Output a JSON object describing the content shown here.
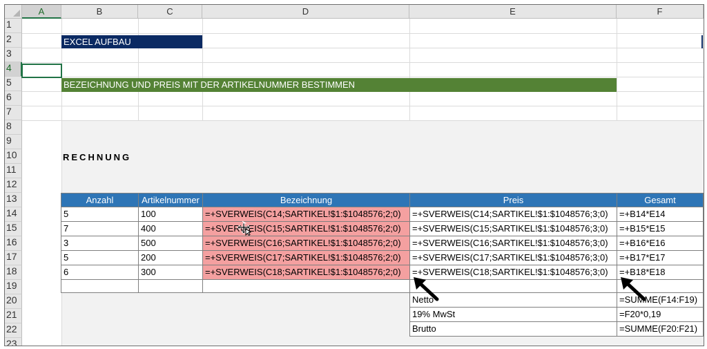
{
  "columns": [
    "A",
    "B",
    "C",
    "D",
    "E",
    "F"
  ],
  "rows": [
    "1",
    "2",
    "3",
    "4",
    "5",
    "6",
    "7",
    "8",
    "9",
    "10",
    "11",
    "12",
    "13",
    "14",
    "15",
    "16",
    "17",
    "18",
    "19",
    "20",
    "21",
    "22",
    "23"
  ],
  "cells": {
    "title": "EXCEL AUFBAU",
    "subtitle": "BEZEICHNUNG UND PREIS  MIT DER ARTIKELNUMMER BESTIMMEN",
    "invoice_heading": "RECHNUNG"
  },
  "table": {
    "headers": [
      "Anzahl",
      "Artikelnummer",
      "Bezeichnung",
      "Preis",
      "Gesamt"
    ],
    "rows": [
      [
        "5",
        "100",
        "=+SVERWEIS(C14;SARTIKEL!$1:$1048576;2;0)",
        "=+SVERWEIS(C14;SARTIKEL!$1:$1048576;3;0)",
        "=+B14*E14"
      ],
      [
        "7",
        "400",
        "=+SVERWEIS(C15;SARTIKEL!$1:$1048576;2;0)",
        "=+SVERWEIS(C15;SARTIKEL!$1:$1048576;3;0)",
        "=+B15*E15"
      ],
      [
        "3",
        "500",
        "=+SVERWEIS(C16;SARTIKEL!$1:$1048576;2;0)",
        "=+SVERWEIS(C16;SARTIKEL!$1:$1048576;3;0)",
        "=+B16*E16"
      ],
      [
        "5",
        "200",
        "=+SVERWEIS(C17;SARTIKEL!$1:$1048576;2;0)",
        "=+SVERWEIS(C17;SARTIKEL!$1:$1048576;3;0)",
        "=+B17*E17"
      ],
      [
        "6",
        "300",
        "=+SVERWEIS(C18;SARTIKEL!$1:$1048576;2;0)",
        "=+SVERWEIS(C18;SARTIKEL!$1:$1048576;3;0)",
        "=+B18*E18"
      ]
    ]
  },
  "summary": [
    {
      "label": "Netto",
      "formula": "=SUMME(F14:F19)"
    },
    {
      "label": "19% MwSt",
      "formula": "=F20*0,19"
    },
    {
      "label": "Brutto",
      "formula": "=SUMME(F20:F21)"
    }
  ],
  "colors": {
    "title_blue": "#0b2a63",
    "title_green": "#548235",
    "header_blue": "#2e75b6",
    "highlight_red": "#f4a0a0",
    "selection_green": "#217346"
  },
  "icons": [
    "move-cursor-icon",
    "arrow-pointer-icon"
  ]
}
